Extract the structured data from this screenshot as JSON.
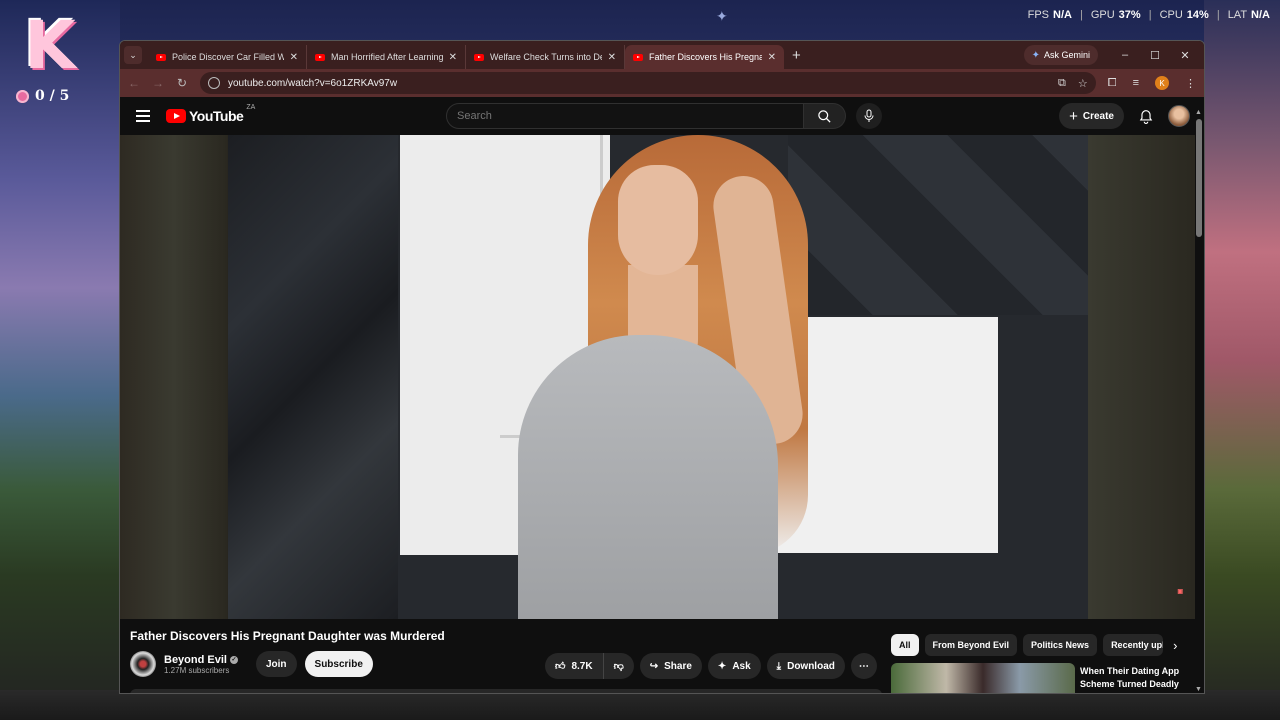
{
  "overlay": {
    "score": "0 / 5",
    "stats": {
      "fps_label": "FPS",
      "fps_value": "N/A",
      "gpu_label": "GPU",
      "gpu_value": "37%",
      "cpu_label": "CPU",
      "cpu_value": "14%",
      "lat_label": "LAT",
      "lat_value": "N/A"
    }
  },
  "browser": {
    "tabs": [
      {
        "title": "Police Discover Car Filled With",
        "active": false
      },
      {
        "title": "Man Horrified After Learning G",
        "active": false
      },
      {
        "title": "Welfare Check Turns into Dead",
        "active": false
      },
      {
        "title": "Father Discovers His Pregnant D",
        "active": true
      }
    ],
    "gemini_label": "Ask Gemini",
    "url": "youtube.com/watch?v=6o1ZRKAv97w",
    "profile_initial": "K"
  },
  "youtube": {
    "logo_text": "YouTube",
    "region": "ZA",
    "search_placeholder": "Search",
    "create_label": "Create",
    "video": {
      "title": "Father Discovers His Pregnant Daughter was Murdered",
      "channel_name": "Beyond Evil",
      "subscribers": "1.27M subscribers",
      "join_label": "Join",
      "subscribe_label": "Subscribe",
      "likes": "8.7K",
      "share_label": "Share",
      "ask_label": "Ask",
      "download_label": "Download"
    },
    "chips": [
      "All",
      "From Beyond Evil",
      "Politics News",
      "Recently uploaded"
    ],
    "recommendation": {
      "title": "When Their Dating App Scheme Turned Deadly"
    }
  }
}
